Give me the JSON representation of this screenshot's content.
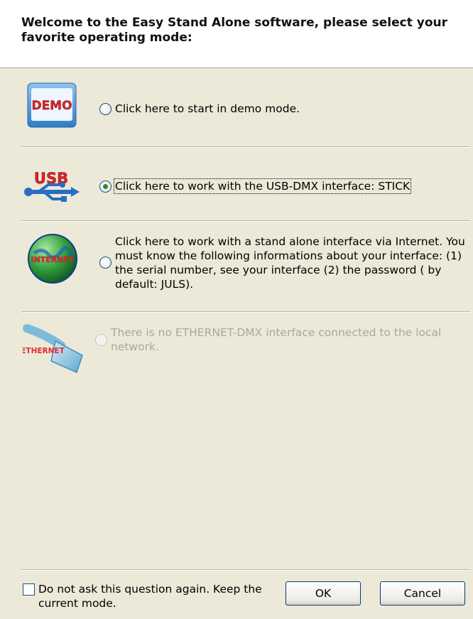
{
  "header": {
    "title": "Welcome to the Easy Stand Alone software, please select your favorite operating mode:"
  },
  "options": [
    {
      "icon_label": "DEMO",
      "text": "Click here to start in demo mode.",
      "selected": false,
      "enabled": true
    },
    {
      "icon_label": "USB",
      "text": "Click here to work with the USB-DMX interface:  STICK",
      "selected": true,
      "enabled": true
    },
    {
      "icon_label": "INTERNET",
      "text": "Click here to work with a stand alone interface via Internet. You must know the following informations about your interface: (1) the serial number, see your interface (2) the password ( by default: JULS).",
      "selected": false,
      "enabled": true
    },
    {
      "icon_label": "ETHERNET",
      "text": "There is no ETHERNET-DMX interface connected to the local network.",
      "selected": false,
      "enabled": false
    }
  ],
  "footer": {
    "checkbox_label": "Do not ask this question again. Keep the current mode.",
    "checkbox_checked": false,
    "ok_label": "OK",
    "cancel_label": "Cancel"
  },
  "colors": {
    "dialog_bg": "#ece9d8",
    "radio_checked_dot": "#2a8b2a",
    "disabled_text": "#aca899",
    "button_border": "#003c74"
  }
}
